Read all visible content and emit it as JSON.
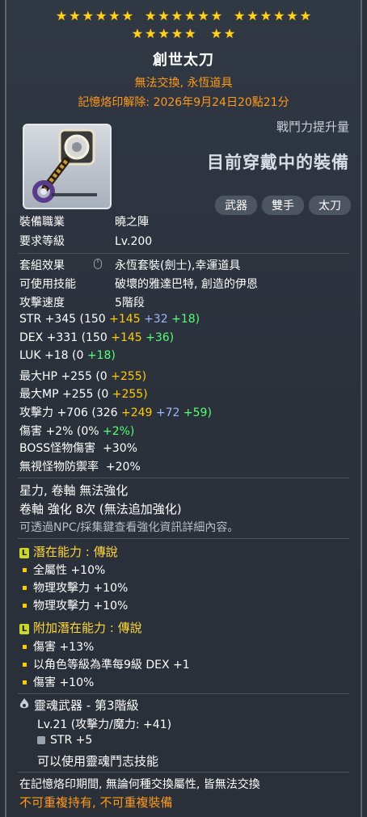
{
  "header": {
    "stars_row1_groups": [
      6,
      6,
      6
    ],
    "stars_row2_groups": [
      5,
      2
    ],
    "title": "創世太刀",
    "subtitle": "無法交換, 永恆道具",
    "seal_release": "記憶烙印解除: 2026年9月24日20點21分",
    "power_label": "戰鬥力提升量",
    "equipped_text": "目前穿戴中的裝備",
    "tags": [
      "武器",
      "雙手",
      "太刀"
    ]
  },
  "requirements": {
    "job_label": "裝備職業",
    "job_value": "曉之陣",
    "level_label": "要求等級",
    "level_value": "Lv.200"
  },
  "info": {
    "set_label": "套組效果",
    "set_value": "永恆套裝(劍士),幸運道具",
    "skill_label": "可使用技能",
    "skill_value": "破壞的雅達巴特, 創造的伊恩",
    "speed_label": "攻擊速度",
    "speed_value": "5階段"
  },
  "stats": [
    {
      "name": "STR",
      "total": "+345",
      "base": "(150",
      "p1": "+145",
      "p2": "+32",
      "p3": "+18)"
    },
    {
      "name": "DEX",
      "total": "+331",
      "base": "(150",
      "p1": "+145",
      "p2": "",
      "p3": "+36)"
    },
    {
      "name": "LUK",
      "total": "+18",
      "base": "(0",
      "p1": "",
      "p2": "",
      "p3": "+18)"
    },
    {
      "name": "最大HP",
      "total": "+255",
      "base": "(0",
      "p1": "+255)",
      "p2": "",
      "p3": ""
    },
    {
      "name": "最大MP",
      "total": "+255",
      "base": "(0",
      "p1": "+255)",
      "p2": "",
      "p3": ""
    },
    {
      "name": "攻擊力",
      "total": "+706",
      "base": "(326",
      "p1": "+249",
      "p2": "+72",
      "p3": "+59)"
    },
    {
      "name": "傷害",
      "total": "+2%",
      "base": "(0%",
      "p1": "",
      "p2": "",
      "p3": "+2%)"
    }
  ],
  "extras": {
    "boss_label": "BOSS怪物傷害",
    "boss_value": "+30%",
    "ignore_label": "無視怪物防禦率",
    "ignore_value": "+20%"
  },
  "enhance": {
    "line1": "星力, 卷軸 無法強化",
    "line2": "卷軸 強化 8次 (無法追加強化)",
    "line3": "可透過NPC/採集鍵查看強化資訊詳細內容。"
  },
  "potential": {
    "title": "潛在能力 : 傳說",
    "lines": [
      "全屬性 +10%",
      "物理攻擊力 +10%",
      "物理攻擊力 +10%"
    ]
  },
  "additional_potential": {
    "title": "附加潛在能力 : 傳說",
    "lines": [
      "傷害 +13%",
      "以角色等級為準每9級 DEX +1",
      "傷害 +10%"
    ]
  },
  "soul": {
    "title": "靈魂武器 - 第3階級",
    "level_line": "Lv.21 (攻擊力/魔力: +41)",
    "stat_line": "STR +5",
    "skill_line": "可以使用靈魂鬥志技能"
  },
  "footer": {
    "line1": "在記憶烙印期間, 無論何種交換屬性, 皆無法交換",
    "line2": "不可重複持有, 不可重複裝備"
  },
  "colors": {
    "star": "#ffd21e",
    "orange": "#ff9a1a",
    "yellow": "#ffcc00",
    "blue": "#9fb5ff",
    "green": "#55ff77",
    "section_title": "#ffd83a"
  },
  "icons": {
    "item": "katana-weapon-icon",
    "set_info": "mouse-icon",
    "potential_badge": "legendary-grade-icon",
    "soul": "soul-flame-icon",
    "soul_stat": "soul-stat-icon"
  }
}
